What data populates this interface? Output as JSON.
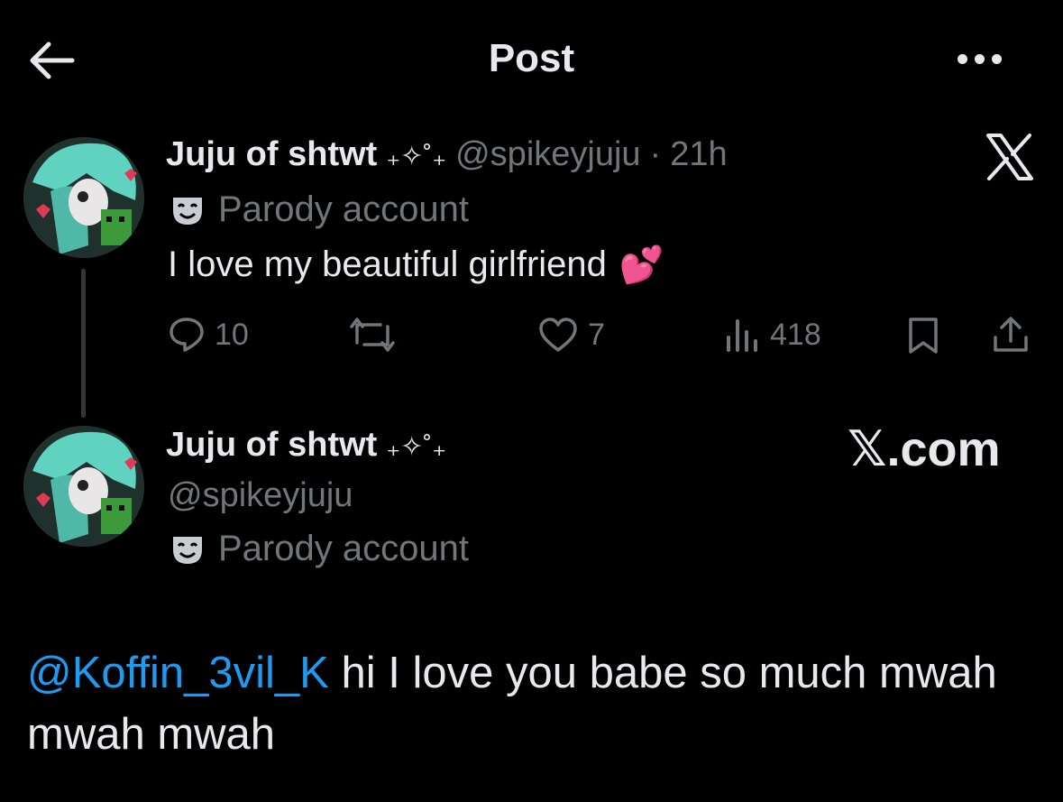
{
  "header": {
    "title": "Post",
    "back_icon": "arrow-left-icon",
    "more_icon": "more-dots-icon"
  },
  "post": {
    "display_name": "Juju of shtwt",
    "name_decoration": "₊✧˚₊",
    "handle": "@spikeyjuju",
    "separator": "·",
    "time": "21h",
    "badge_label": "Parody account",
    "text": "I love my beautiful girlfriend",
    "text_emoji": "💕",
    "stats": {
      "replies": "10",
      "reposts": "",
      "likes": "7",
      "views": "418"
    }
  },
  "reply_author": {
    "display_name": "Juju of shtwt",
    "name_decoration": "₊✧˚₊",
    "handle": "@spikeyjuju",
    "badge_label": "Parody account"
  },
  "brand": {
    "xcom_label": "𝕏.com",
    "logo_icon": "x-logo-icon"
  },
  "reply": {
    "mention": "@Koffin_3vil_K",
    "text": " hi I love you babe so much mwah mwah mwah"
  },
  "colors": {
    "background": "#000000",
    "primary_text": "#e7e9ea",
    "secondary_text": "#71767b",
    "accent_blue": "#1d9bf0"
  }
}
